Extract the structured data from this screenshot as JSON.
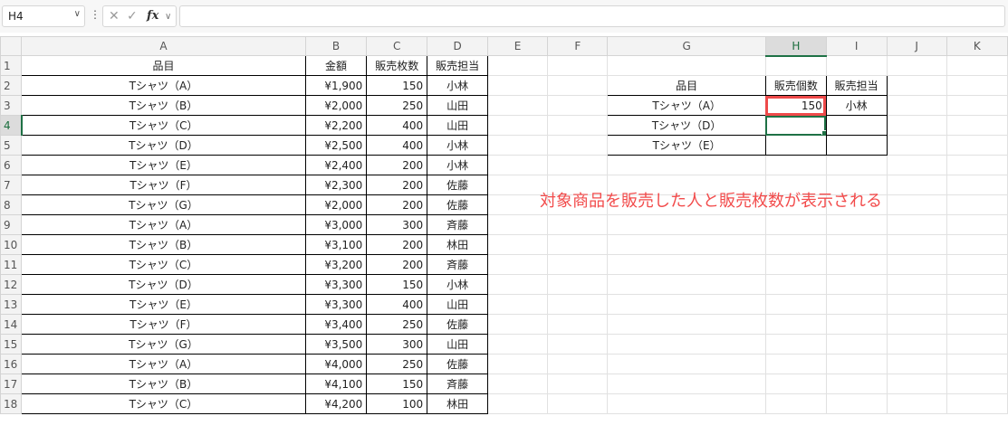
{
  "formula_bar": {
    "name_box": "H4",
    "formula": ""
  },
  "grid": {
    "columns": [
      "A",
      "B",
      "C",
      "D",
      "E",
      "F",
      "G",
      "H",
      "I",
      "J",
      "K"
    ],
    "selected_column": "H",
    "selected_row": 4,
    "rows": [
      {
        "n": "1",
        "a": "品目",
        "b": "金額",
        "c": "販売枚数",
        "d": "販売担当",
        "g": "",
        "h": "",
        "i": ""
      },
      {
        "n": "2",
        "a": "Tシャツ（A）",
        "b": "¥1,900",
        "c": "150",
        "d": "小林",
        "g": "品目",
        "h": "販売個数",
        "i": "販売担当"
      },
      {
        "n": "3",
        "a": "Tシャツ（B）",
        "b": "¥2,000",
        "c": "250",
        "d": "山田",
        "g": "Tシャツ（A）",
        "h": "150",
        "i": "小林"
      },
      {
        "n": "4",
        "a": "Tシャツ（C）",
        "b": "¥2,200",
        "c": "400",
        "d": "山田",
        "g": "Tシャツ（D）",
        "h": "",
        "i": ""
      },
      {
        "n": "5",
        "a": "Tシャツ（D）",
        "b": "¥2,500",
        "c": "400",
        "d": "小林",
        "g": "Tシャツ（E）",
        "h": "",
        "i": ""
      },
      {
        "n": "6",
        "a": "Tシャツ（E）",
        "b": "¥2,400",
        "c": "200",
        "d": "小林",
        "g": "",
        "h": "",
        "i": ""
      },
      {
        "n": "7",
        "a": "Tシャツ（F）",
        "b": "¥2,300",
        "c": "200",
        "d": "佐藤",
        "g": "",
        "h": "",
        "i": ""
      },
      {
        "n": "8",
        "a": "Tシャツ（G）",
        "b": "¥2,000",
        "c": "200",
        "d": "佐藤",
        "g": "",
        "h": "",
        "i": ""
      },
      {
        "n": "9",
        "a": "Tシャツ（A）",
        "b": "¥3,000",
        "c": "300",
        "d": "斉藤",
        "g": "",
        "h": "",
        "i": ""
      },
      {
        "n": "10",
        "a": "Tシャツ（B）",
        "b": "¥3,100",
        "c": "200",
        "d": "林田",
        "g": "",
        "h": "",
        "i": ""
      },
      {
        "n": "11",
        "a": "Tシャツ（C）",
        "b": "¥3,200",
        "c": "200",
        "d": "斉藤",
        "g": "",
        "h": "",
        "i": ""
      },
      {
        "n": "12",
        "a": "Tシャツ（D）",
        "b": "¥3,300",
        "c": "150",
        "d": "小林",
        "g": "",
        "h": "",
        "i": ""
      },
      {
        "n": "13",
        "a": "Tシャツ（E）",
        "b": "¥3,300",
        "c": "400",
        "d": "山田",
        "g": "",
        "h": "",
        "i": ""
      },
      {
        "n": "14",
        "a": "Tシャツ（F）",
        "b": "¥3,400",
        "c": "250",
        "d": "佐藤",
        "g": "",
        "h": "",
        "i": ""
      },
      {
        "n": "15",
        "a": "Tシャツ（G）",
        "b": "¥3,500",
        "c": "300",
        "d": "山田",
        "g": "",
        "h": "",
        "i": ""
      },
      {
        "n": "16",
        "a": "Tシャツ（A）",
        "b": "¥4,000",
        "c": "250",
        "d": "佐藤",
        "g": "",
        "h": "",
        "i": ""
      },
      {
        "n": "17",
        "a": "Tシャツ（B）",
        "b": "¥4,100",
        "c": "150",
        "d": "斉藤",
        "g": "",
        "h": "",
        "i": ""
      },
      {
        "n": "18",
        "a": "Tシャツ（C）",
        "b": "¥4,200",
        "c": "100",
        "d": "林田",
        "g": "",
        "h": "",
        "i": ""
      }
    ]
  },
  "annotation": "対象商品を販売した人と販売枚数が表示される",
  "colors": {
    "highlight": "#ee4a4a",
    "annotation": "#f24b4b",
    "selection": "#1e7145"
  }
}
